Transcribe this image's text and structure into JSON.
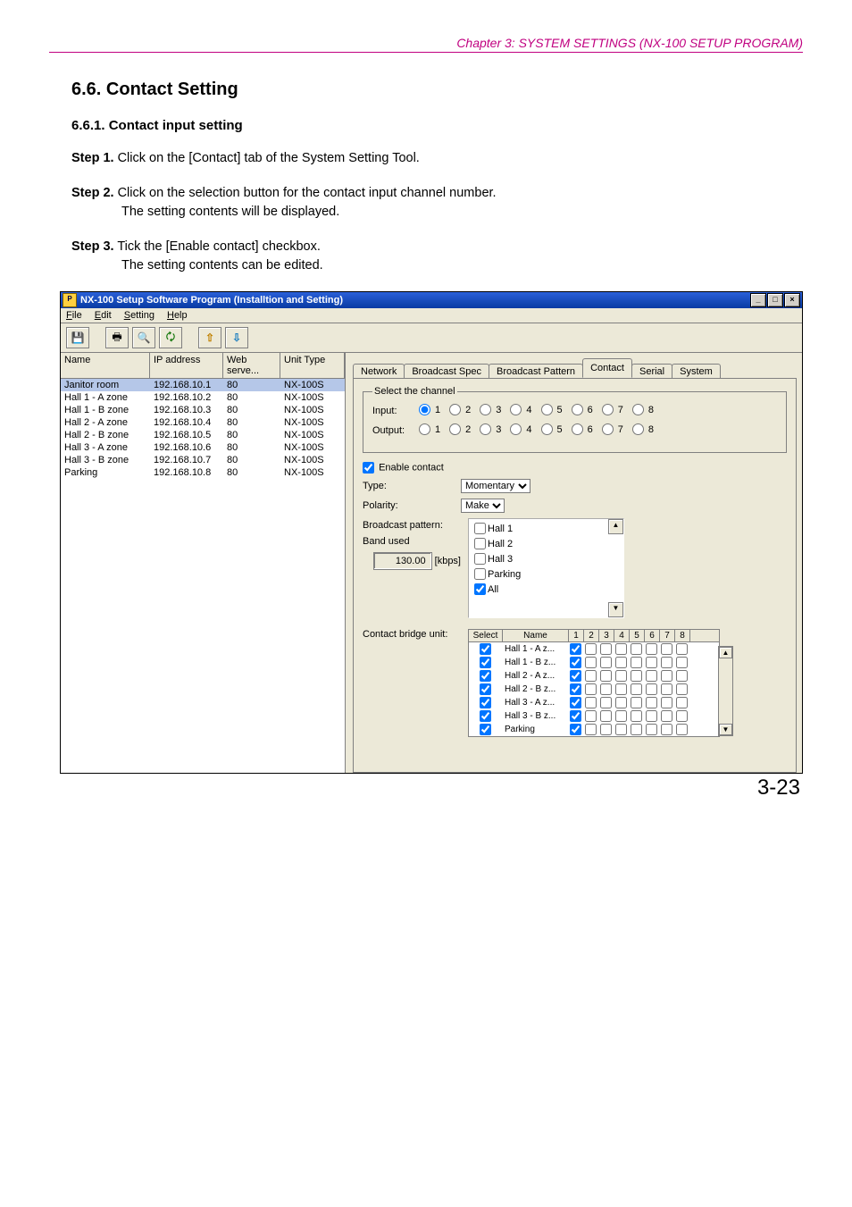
{
  "chapter": "Chapter 3:  SYSTEM SETTINGS (NX-100 SETUP PROGRAM)",
  "section": {
    "num": "6.6.",
    "title": "Contact Setting"
  },
  "subsection": {
    "num": "6.6.1.",
    "title": "Contact input setting"
  },
  "steps": [
    {
      "label": "Step 1.",
      "line1": "Click on the [Contact] tab of the System Setting Tool.",
      "line2": ""
    },
    {
      "label": "Step 2.",
      "line1": "Click on the selection button for the contact input channel number.",
      "line2": "The setting contents will be displayed."
    },
    {
      "label": "Step 3.",
      "line1": "Tick the [Enable contact] checkbox.",
      "line2": "The setting contents can be edited."
    }
  ],
  "app": {
    "title": "NX-100 Setup Software Program (Installtion and Setting)",
    "menubar": [
      "File",
      "Edit",
      "Setting",
      "Help"
    ],
    "toolbar_icons": [
      "save-icon",
      "print-icon",
      "scan-icon",
      "folder-icon",
      "upload-icon",
      "download-icon"
    ],
    "unit_headers": [
      "Name",
      "IP address",
      "Web serve...",
      "Unit Type"
    ],
    "units": [
      {
        "name": "Janitor room",
        "ip": "192.168.10.1",
        "port": "80",
        "type": "NX-100S",
        "selected": true
      },
      {
        "name": "Hall 1 - A zone",
        "ip": "192.168.10.2",
        "port": "80",
        "type": "NX-100S",
        "selected": false
      },
      {
        "name": "Hall 1 - B zone",
        "ip": "192.168.10.3",
        "port": "80",
        "type": "NX-100S",
        "selected": false
      },
      {
        "name": "Hall 2 - A zone",
        "ip": "192.168.10.4",
        "port": "80",
        "type": "NX-100S",
        "selected": false
      },
      {
        "name": "Hall 2 - B zone",
        "ip": "192.168.10.5",
        "port": "80",
        "type": "NX-100S",
        "selected": false
      },
      {
        "name": "Hall 3 - A zone",
        "ip": "192.168.10.6",
        "port": "80",
        "type": "NX-100S",
        "selected": false
      },
      {
        "name": "Hall 3 - B zone",
        "ip": "192.168.10.7",
        "port": "80",
        "type": "NX-100S",
        "selected": false
      },
      {
        "name": "Parking",
        "ip": "192.168.10.8",
        "port": "80",
        "type": "NX-100S",
        "selected": false
      }
    ],
    "tabs": [
      "Network",
      "Broadcast Spec",
      "Broadcast Pattern",
      "Contact",
      "Serial",
      "System"
    ],
    "active_tab": 3,
    "channel_legend": "Select the channel",
    "input_label": "Input:",
    "output_label": "Output:",
    "channel_nums": [
      "1",
      "2",
      "3",
      "4",
      "5",
      "6",
      "7",
      "8"
    ],
    "input_selected": 0,
    "output_selected": -1,
    "enable_label": "Enable contact",
    "enable_checked": true,
    "type_label": "Type:",
    "type_value": "Momentary",
    "polarity_label": "Polarity:",
    "polarity_value": "Make",
    "bp_label1": "Broadcast pattern:",
    "bp_label2": "Band used",
    "band_value": "130.00",
    "band_unit": "[kbps]",
    "patterns": [
      {
        "name": "Hall 1",
        "checked": false
      },
      {
        "name": "Hall 2",
        "checked": false
      },
      {
        "name": "Hall 3",
        "checked": false
      },
      {
        "name": "Parking",
        "checked": false
      },
      {
        "name": "All",
        "checked": true
      }
    ],
    "bridge_label": "Contact bridge unit:",
    "bridge_head_select": "Select",
    "bridge_head_name": "Name",
    "bridge_cols": [
      "1",
      "2",
      "3",
      "4",
      "5",
      "6",
      "7",
      "8"
    ],
    "bridge_rows": [
      {
        "sel": true,
        "name": "Hall 1 - A z...",
        "c": [
          true,
          false,
          false,
          false,
          false,
          false,
          false,
          false
        ]
      },
      {
        "sel": true,
        "name": "Hall 1 - B z...",
        "c": [
          true,
          false,
          false,
          false,
          false,
          false,
          false,
          false
        ]
      },
      {
        "sel": true,
        "name": "Hall 2 - A z...",
        "c": [
          true,
          false,
          false,
          false,
          false,
          false,
          false,
          false
        ]
      },
      {
        "sel": true,
        "name": "Hall 2 - B z...",
        "c": [
          true,
          false,
          false,
          false,
          false,
          false,
          false,
          false
        ]
      },
      {
        "sel": true,
        "name": "Hall 3 - A z...",
        "c": [
          true,
          false,
          false,
          false,
          false,
          false,
          false,
          false
        ]
      },
      {
        "sel": true,
        "name": "Hall 3 - B z...",
        "c": [
          true,
          false,
          false,
          false,
          false,
          false,
          false,
          false
        ]
      },
      {
        "sel": true,
        "name": "Parking",
        "c": [
          true,
          false,
          false,
          false,
          false,
          false,
          false,
          false
        ]
      }
    ]
  },
  "page_number": "3-23"
}
